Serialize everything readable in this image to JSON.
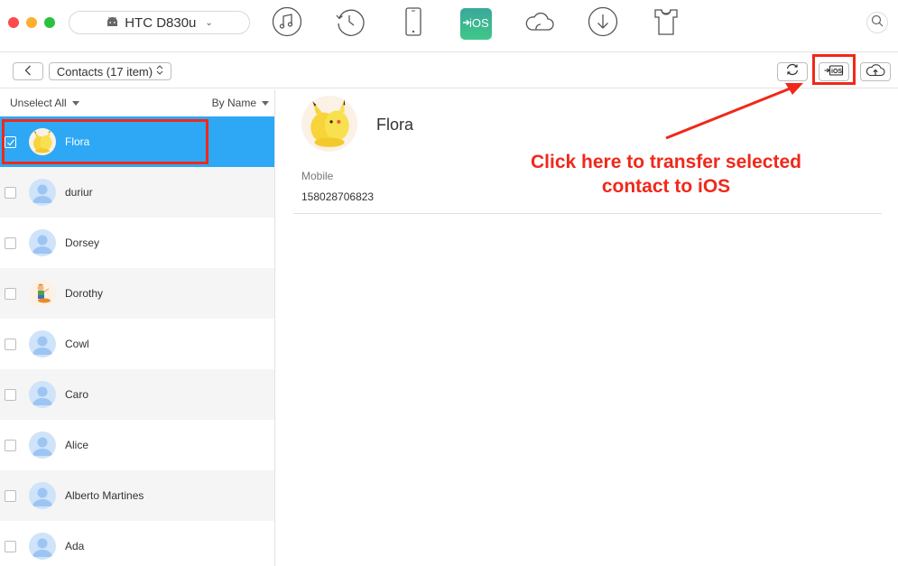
{
  "window": {
    "traffic_lights": [
      "close",
      "minimize",
      "zoom"
    ]
  },
  "header": {
    "device_name": "HTC D830u",
    "device_icon": "android-icon",
    "nav_icons": [
      {
        "name": "music-icon",
        "label": "Music"
      },
      {
        "name": "history-icon",
        "label": "History"
      },
      {
        "name": "phone-icon",
        "label": "Phone"
      },
      {
        "name": "to-ios-icon",
        "label": "iOS",
        "active": true
      },
      {
        "name": "cloud-icon",
        "label": "Cloud"
      },
      {
        "name": "download-icon",
        "label": "Download"
      },
      {
        "name": "tshirt-icon",
        "label": "Skin"
      }
    ],
    "search_icon": "search-icon"
  },
  "toolbar": {
    "back_icon": "chevron-left-icon",
    "category": "Contacts (17 item)",
    "buttons": [
      {
        "name": "refresh-icon"
      },
      {
        "name": "to-ios-icon",
        "label": "iOS"
      },
      {
        "name": "cloud-upload-icon"
      }
    ]
  },
  "list": {
    "select_toggle": "Unselect All",
    "sort": "By Name",
    "contacts": [
      {
        "name": "Flora",
        "avatar": "photo",
        "checked": true,
        "selected": true
      },
      {
        "name": "duriur",
        "avatar": "generic",
        "checked": false
      },
      {
        "name": "Dorsey",
        "avatar": "generic",
        "checked": false
      },
      {
        "name": "Dorothy",
        "avatar": "photo",
        "checked": false
      },
      {
        "name": "Cowl",
        "avatar": "generic",
        "checked": false
      },
      {
        "name": "Caro",
        "avatar": "generic",
        "checked": false
      },
      {
        "name": "Alice",
        "avatar": "generic",
        "checked": false
      },
      {
        "name": "Alberto Martines",
        "avatar": "generic",
        "checked": false
      },
      {
        "name": "Ada",
        "avatar": "generic",
        "checked": false
      }
    ]
  },
  "detail": {
    "name": "Flora",
    "fields": [
      {
        "label": "Mobile",
        "value": "158028706823"
      }
    ]
  },
  "annotation": {
    "line1": "Click here to transfer selected",
    "line2": "contact to iOS",
    "color": "#f0281a"
  },
  "colors": {
    "selection": "#2ea8f5",
    "ios_tile_top": "#3aa89a",
    "ios_tile_bottom": "#3fc78a",
    "highlight": "#f0281a"
  }
}
